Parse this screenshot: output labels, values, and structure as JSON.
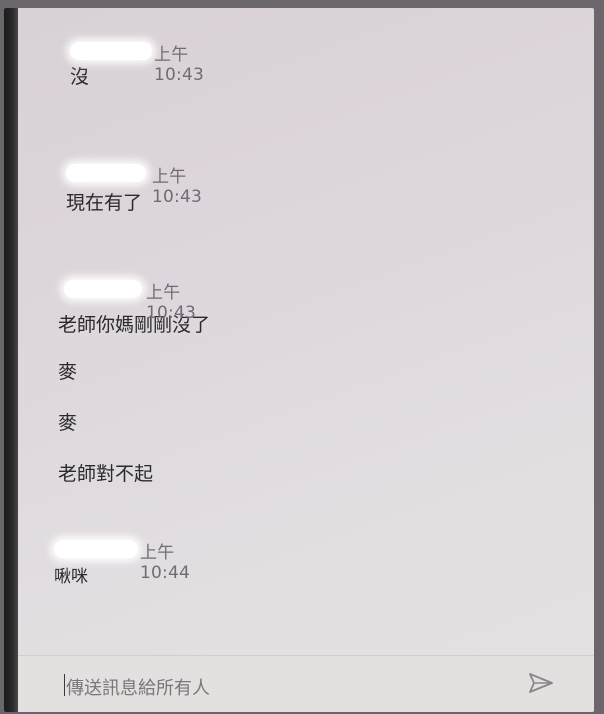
{
  "chat": {
    "groups": [
      {
        "timestamp": "上午10:43",
        "messages": [
          "沒"
        ]
      },
      {
        "timestamp": "上午10:43",
        "messages": [
          "現在有了"
        ]
      },
      {
        "timestamp": "上午10:43",
        "messages": [
          "老師你媽剛剛沒了",
          "麥",
          "麥",
          "老師對不起"
        ]
      },
      {
        "timestamp": "上午10:44",
        "messages": [
          "啾咪"
        ]
      }
    ]
  },
  "compose": {
    "placeholder": "傳送訊息給所有人",
    "send_icon": "send-icon"
  },
  "colors": {
    "screen_bg": "#e0dadd",
    "text": "#2a2a2e",
    "timestamp": "#706c74",
    "placeholder": "#7a767a"
  }
}
